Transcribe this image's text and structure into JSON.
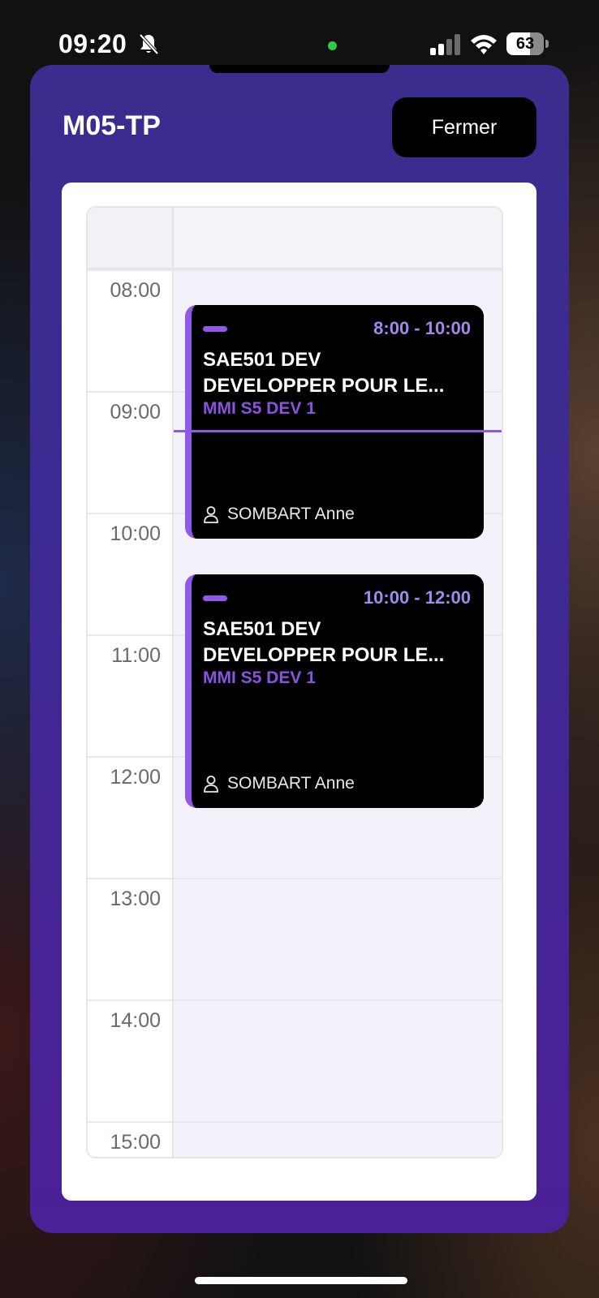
{
  "status_bar": {
    "time": "09:20",
    "battery": "63",
    "icons": [
      "bell-off-icon",
      "camera-indicator-icon",
      "signal-icon",
      "wifi-icon",
      "battery-icon"
    ]
  },
  "modal": {
    "title": "M05-TP",
    "close_label": "Fermer"
  },
  "calendar": {
    "hours": [
      "08:00",
      "09:00",
      "10:00",
      "11:00",
      "12:00",
      "13:00",
      "14:00",
      "15:00"
    ],
    "events": [
      {
        "time": "8:00 - 10:00",
        "title_line1": "SAE501 DEV",
        "title_line2": "DEVELOPPER POUR LE...",
        "group": "MMI S5 DEV 1",
        "teacher": "SOMBART Anne"
      },
      {
        "time": "10:00 - 12:00",
        "title_line1": "SAE501 DEV",
        "title_line2": "DEVELOPPER POUR LE...",
        "group": "MMI S5 DEV 1",
        "teacher": "SOMBART Anne"
      }
    ]
  },
  "colors": {
    "accent": "#9159e6",
    "modal_top": "#3a2d8e",
    "modal_bottom": "#4c2097",
    "event_bg": "#000000"
  }
}
